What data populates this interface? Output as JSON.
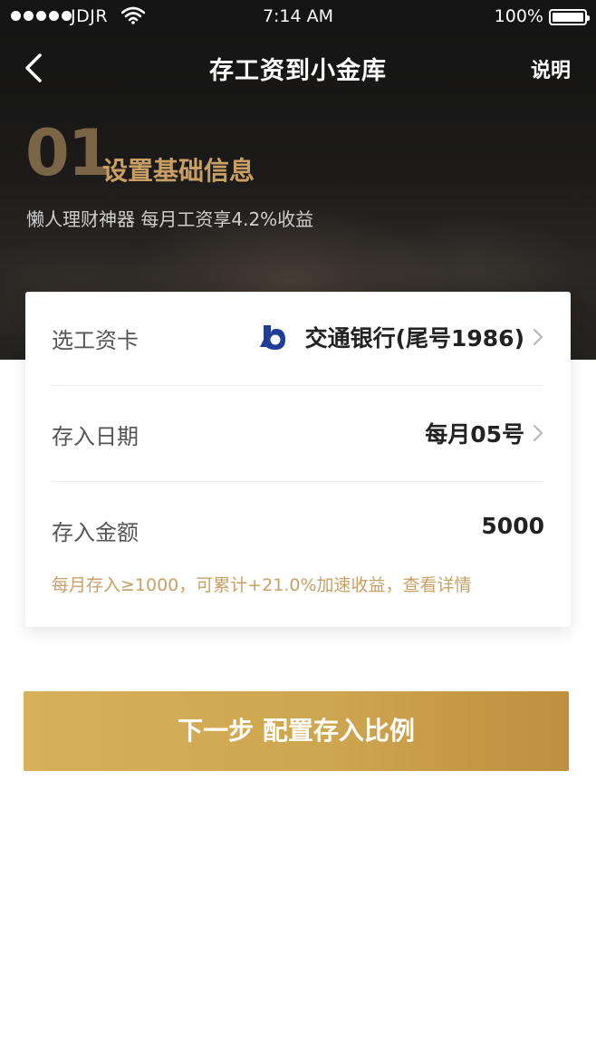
{
  "status_bar": {
    "carrier": "JDJR",
    "time": "7:14 AM",
    "battery": "100%"
  },
  "nav": {
    "title": "存工资到小金库",
    "right_label": "说明"
  },
  "step": {
    "number": "01",
    "title": "设置基础信息",
    "subtitle": "懒人理财神器 每月工资享4.2%收益"
  },
  "form": {
    "card_row": {
      "label": "选工资卡",
      "value": "交通银行(尾号1986)"
    },
    "date_row": {
      "label": "存入日期",
      "value": "每月05号"
    },
    "amount_row": {
      "label": "存入金额",
      "value": "5000"
    },
    "hint": "每月存入≥1000，可累计+21.0%加速收益，查看详情"
  },
  "cta": {
    "label": "下一步 配置存入比例"
  },
  "colors": {
    "accent_gold": "#c9a064",
    "cta_start": "#d7b05a",
    "cta_end": "#bf8f3f",
    "bank_blue": "#1f3d99"
  },
  "icons": [
    "signal-icon",
    "wifi-icon",
    "battery-icon",
    "back-arrow-icon",
    "bank-logo-icon",
    "chevron-right-icon"
  ]
}
